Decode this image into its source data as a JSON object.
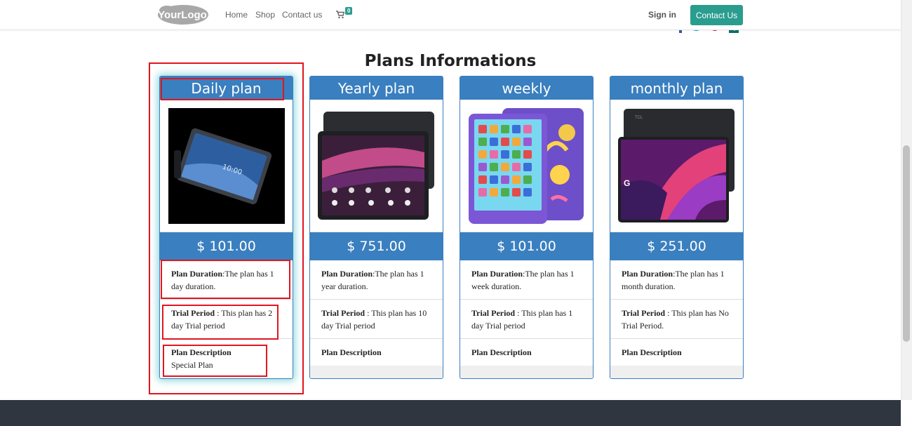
{
  "navbar": {
    "logo_text": "YourLogo",
    "links": [
      "Home",
      "Shop",
      "Contact us"
    ],
    "cart_count": "0",
    "signin": "Sign in",
    "contact_button": "Contact Us"
  },
  "section": {
    "title": "Plans Informations"
  },
  "plans": [
    {
      "name": "Daily plan",
      "price": "$ 101.00",
      "duration_label": "Plan Duration",
      "duration_text": ":The plan has 1 day duration.",
      "trial_label": "Trial Period",
      "trial_text": " : This plan has 2 day Trial period",
      "desc_label": "Plan Description",
      "desc_text": "Special Plan"
    },
    {
      "name": "Yearly plan",
      "price": "$ 751.00",
      "duration_label": "Plan Duration",
      "duration_text": ":The plan has 1 year duration.",
      "trial_label": "Trial Period",
      "trial_text": " : This plan has 10 day Trial period",
      "desc_label": "Plan Description",
      "desc_text": ""
    },
    {
      "name": "weekly",
      "price": "$ 101.00",
      "duration_label": "Plan Duration",
      "duration_text": ":The plan has 1 week duration.",
      "trial_label": "Trial Period",
      "trial_text": " : This plan has 1 day Trial period",
      "desc_label": "Plan Description",
      "desc_text": ""
    },
    {
      "name": "monthly plan",
      "price": "$ 251.00",
      "duration_label": "Plan Duration",
      "duration_text": ":The plan has 1 month duration.",
      "trial_label": "Trial Period",
      "trial_text": " : This plan has No Trial Period.",
      "desc_label": "Plan Description",
      "desc_text": ""
    }
  ],
  "colors": {
    "primary": "#3a7fbf",
    "accent": "#2a9d8f",
    "annotation": "#e0161f",
    "footer": "#2f3640"
  }
}
